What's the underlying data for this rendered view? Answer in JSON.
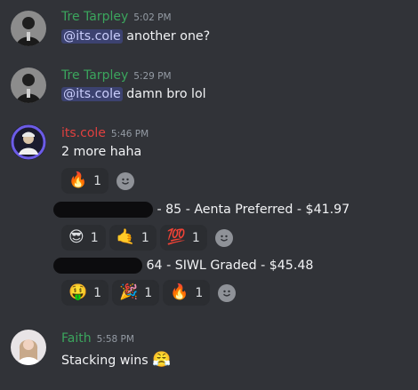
{
  "messages": [
    {
      "username": "Tre Tarpley",
      "time": "5:02 PM",
      "mention": "@its.cole",
      "text": "another one?"
    },
    {
      "username": "Tre Tarpley",
      "time": "5:29 PM",
      "mention": "@its.cole",
      "text": "damn bro lol"
    },
    {
      "username": "its.cole",
      "time": "5:46 PM",
      "text": "2 more haha",
      "reactions": [
        {
          "emoji": "🔥",
          "count": "1",
          "icon": "fire-icon"
        }
      ],
      "line2": "Pioneers - 85 - Aenta Preferred - $41.97",
      "line2_visible": "- 85 - Aenta Preferred - $41.97",
      "reactions2": [
        {
          "emoji": "😎",
          "count": "1",
          "icon": "sunglasses-face-icon"
        },
        {
          "emoji": "🤙",
          "count": "1",
          "icon": "call-me-hand-icon"
        },
        {
          "emoji": "💯",
          "count": "1",
          "icon": "hundred-points-icon"
        }
      ],
      "line3_visible": "64 - SIWL Graded - $45.48",
      "reactions3": [
        {
          "emoji": "🤑",
          "count": "1",
          "icon": "money-mouth-face-icon"
        },
        {
          "emoji": "🎉",
          "count": "1",
          "icon": "party-popper-icon"
        },
        {
          "emoji": "🔥",
          "count": "1",
          "icon": "fire-icon"
        }
      ]
    },
    {
      "username": "Faith",
      "time": "5:58 PM",
      "text": "Stacking wins",
      "emoji": "😤"
    }
  ]
}
